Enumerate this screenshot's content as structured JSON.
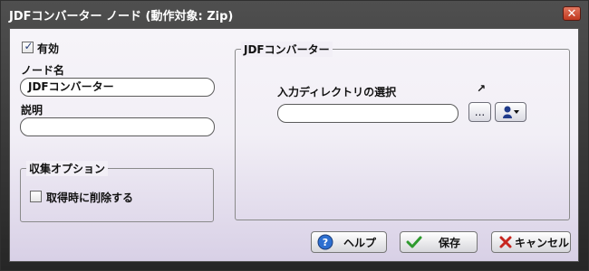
{
  "window": {
    "title": "JDFコンバーター ノード (動作対象: Zip)",
    "close_icon": "close-icon"
  },
  "left": {
    "enabled_label": "有効",
    "enabled_checked": true,
    "node_name_label": "ノード名",
    "node_name_value": "JDFコンバーター",
    "description_label": "説明",
    "description_value": "",
    "collect_options_title": "収集オプション",
    "delete_on_get_label": "取得時に削除する",
    "delete_on_get_checked": false
  },
  "right": {
    "group_title": "JDFコンバーター",
    "input_dir_label": "入力ディレクトリの選択",
    "input_dir_value": "",
    "browse_button": "...",
    "link_icon": "arrow-up-right-icon",
    "user_menu_icon": "user-dropdown-icon"
  },
  "footer": {
    "help_label": "ヘルプ",
    "save_label": "保存",
    "cancel_label": "キャンセル"
  }
}
